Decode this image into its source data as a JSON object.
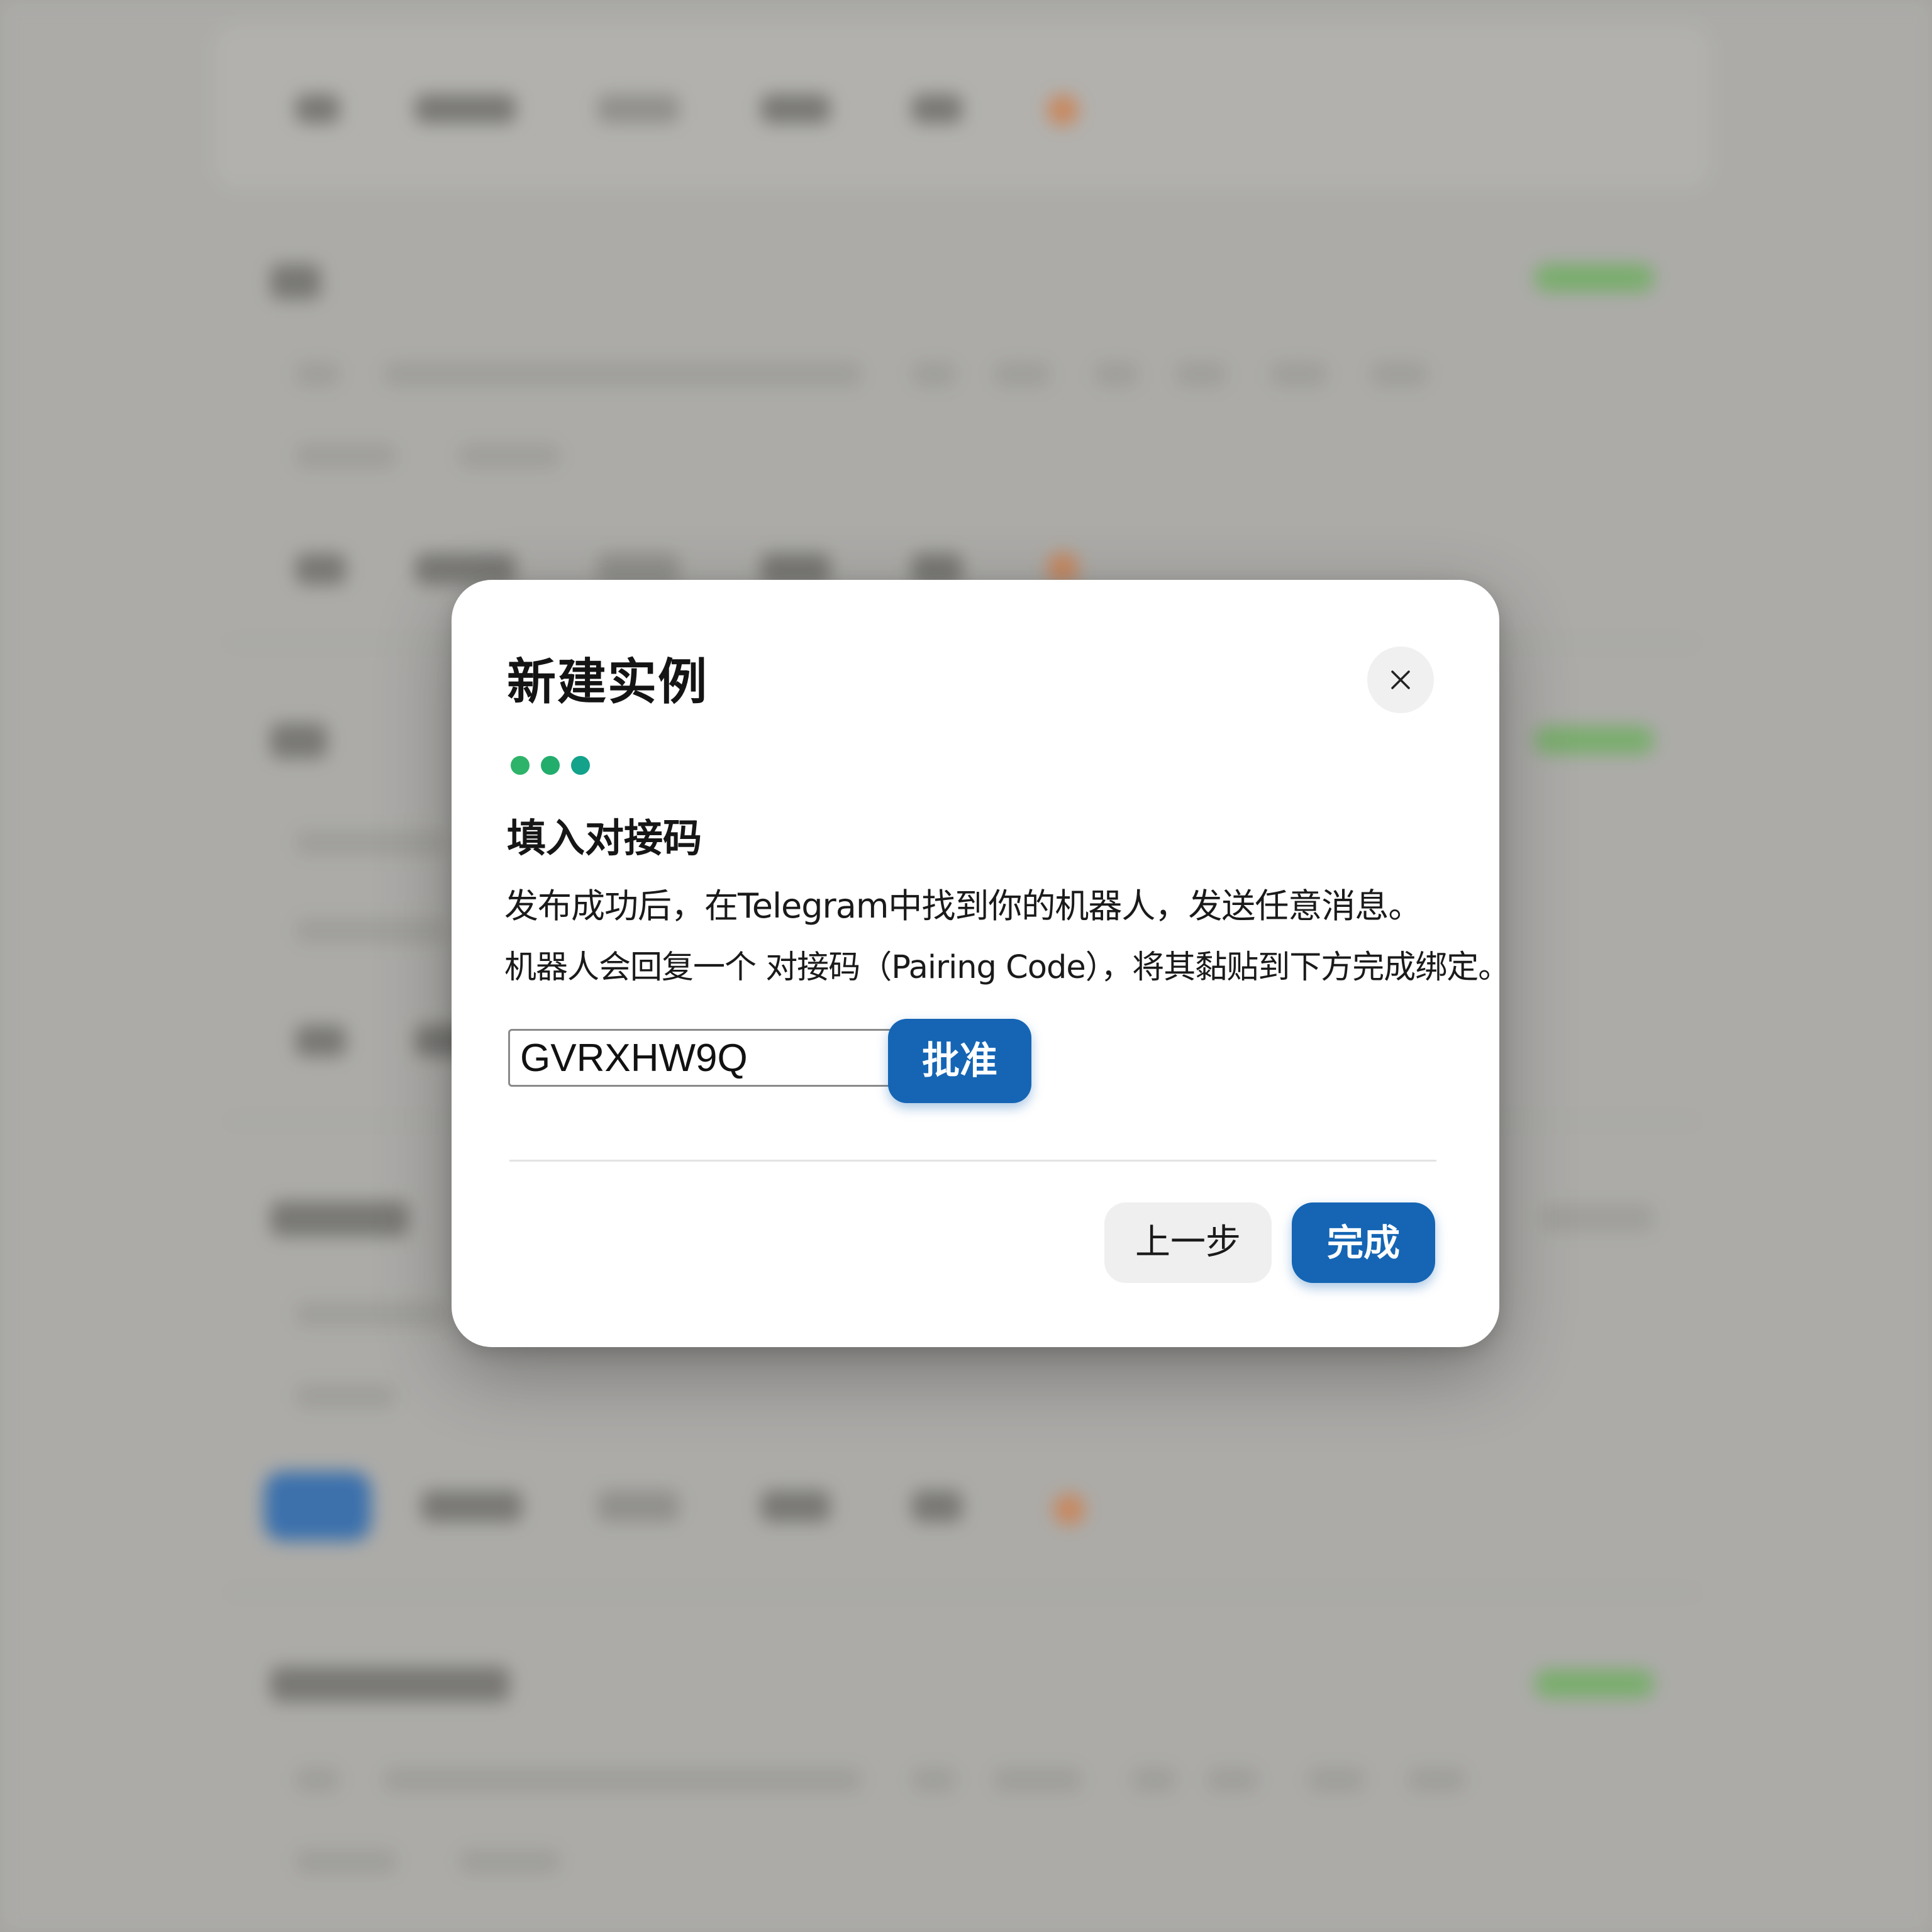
{
  "dialog": {
    "title": "新建实例",
    "step_title": "填入对接码",
    "description_line1": "发布成功后，在Telegram中找到你的机器人，发送任意消息。",
    "description_line2": "机器人会回复一个 对接码（Pairing Code），将其黏贴到下方完成绑定。",
    "pairing_code_value": "GVRXHW9Q",
    "approve_label": "批准",
    "prev_label": "上一步",
    "done_label": "完成",
    "close_icon": "close-icon",
    "step_colors": [
      "#2db36a",
      "#22ad6c",
      "#13a28a"
    ]
  },
  "colors": {
    "primary": "#1565b4",
    "secondary_button_bg": "#efefef",
    "overlay": "#a9a8a5"
  }
}
